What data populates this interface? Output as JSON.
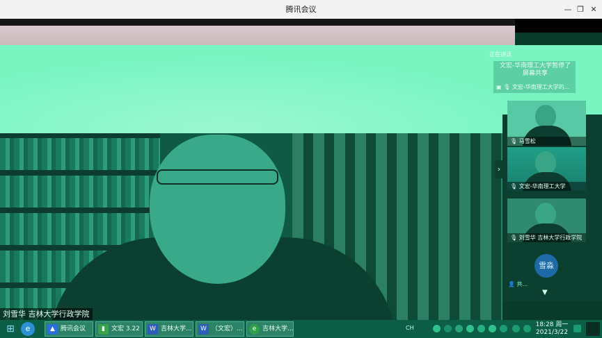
{
  "window": {
    "title": "腾讯会议",
    "min": "—",
    "restore": "❐",
    "close": "✕"
  },
  "main_video": {
    "speaker_label": "刘雪华 吉林大学行政学院"
  },
  "panel": {
    "header": "正在讲话",
    "share_notice": "文宏-华南理工大学暂停了屏幕共享",
    "share_source": "文宏-华南理工大学的...",
    "participants": [
      {
        "name": "马雪松"
      },
      {
        "name": "文宏-华南理工大学"
      },
      {
        "name": "刘雪华 吉林大学行政学院"
      }
    ],
    "avatar_text": "雪淼",
    "member_text": "共..."
  },
  "taskbar": {
    "tasks": [
      {
        "label": "腾讯会议",
        "icon": "tencent-meeting-icon",
        "color": "#2b6fd6"
      },
      {
        "label": "文宏 3.22",
        "icon": "folder-icon",
        "color": "#3aa34a"
      },
      {
        "label": "吉林大学...",
        "icon": "word-icon",
        "color": "#2c5bb8"
      },
      {
        "label": "（文宏）...",
        "icon": "word-icon",
        "color": "#2c5bb8"
      },
      {
        "label": "吉林大学...",
        "icon": "browser-icon",
        "color": "#2fa14a"
      }
    ],
    "lang": "CH",
    "time": "18:28 周一",
    "date": "2021/3/22"
  }
}
